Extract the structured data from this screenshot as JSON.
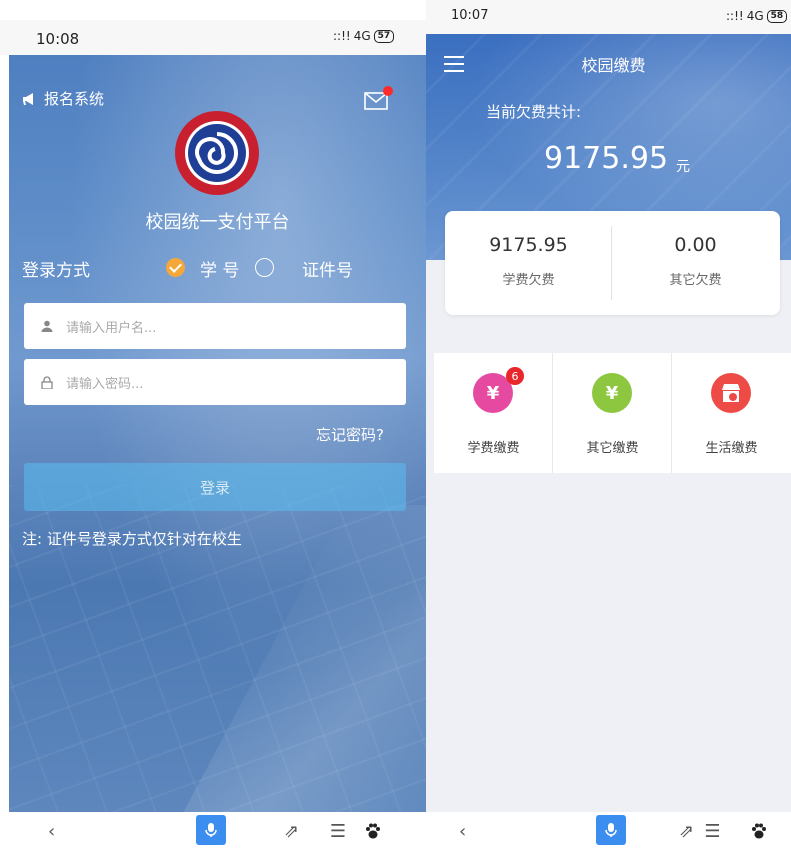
{
  "left_screen": {
    "status": {
      "time": "10:08",
      "signal": "4G",
      "battery": "57"
    },
    "header": {
      "system_label": "报名系统"
    },
    "platform_title": "校园统一支付平台",
    "login_mode": {
      "label": "登录方式",
      "option_student_id": "学 号",
      "option_id_card": "证件号",
      "selected": "学 号"
    },
    "username": {
      "placeholder": "请输入用户名..."
    },
    "password": {
      "placeholder": "请输入密码..."
    },
    "forgot_password": "忘记密码?",
    "login_button": "登录",
    "note": "注: 证件号登录方式仅针对在校生"
  },
  "right_screen": {
    "status": {
      "time": "10:07",
      "signal": "4G",
      "battery": "58"
    },
    "title": "校园缴费",
    "owed_label": "当前欠费共计:",
    "owed_amount": "9175.95",
    "owed_unit": "元",
    "summary": [
      {
        "value": "9175.95",
        "label": "学费欠费"
      },
      {
        "value": "0.00",
        "label": "其它欠费"
      }
    ],
    "payments": [
      {
        "label": "学费缴费",
        "icon": "tuition-icon",
        "color": "#e64aa0",
        "badge": "6"
      },
      {
        "label": "其它缴费",
        "icon": "other-fee-icon",
        "color": "#8dc63f"
      },
      {
        "label": "生活缴费",
        "icon": "store-icon",
        "color": "#ef4b46"
      }
    ]
  },
  "nav_icons": [
    "back-icon",
    "menu-icon",
    "mic-icon",
    "share-icon",
    "paw-icon"
  ],
  "colors": {
    "login_button": "#5abef0",
    "accent_orange": "#f5a83a",
    "mic_blue": "#3b8df0"
  }
}
